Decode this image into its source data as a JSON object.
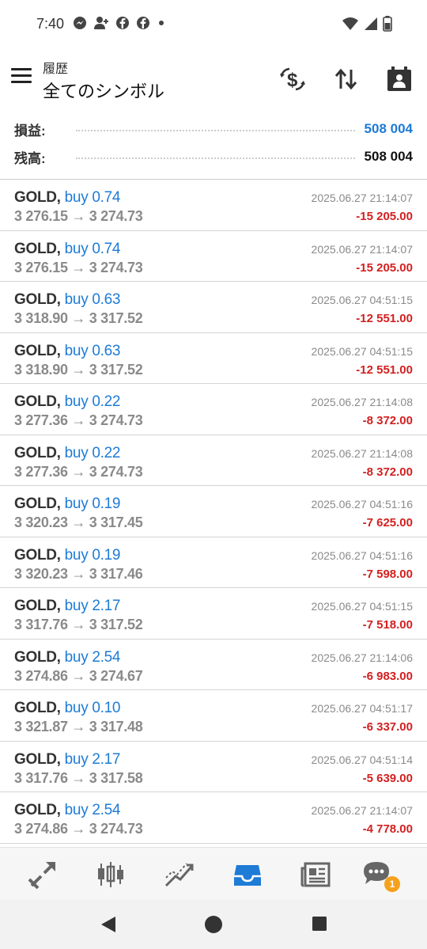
{
  "status": {
    "time": "7:40",
    "left_icons": [
      "messenger-icon",
      "add-person-icon",
      "facebook-icon",
      "facebook-icon",
      "dot-icon"
    ],
    "right_icons": [
      "wifi-icon",
      "signal-icon",
      "battery-icon"
    ]
  },
  "header": {
    "subtitle": "履歴",
    "title": "全てのシンボル"
  },
  "summary": {
    "profit_label": "損益:",
    "profit_value": "508 004",
    "profit_color": "#1e7bd6",
    "balance_label": "残高:",
    "balance_value": "508 004"
  },
  "trades": [
    {
      "symbol": "GOLD,",
      "side": "buy 0.74",
      "prices": "3 276.15 → 3 274.73",
      "time": "2025.06.27 21:14:07",
      "profit": "-15 205.00"
    },
    {
      "symbol": "GOLD,",
      "side": "buy 0.74",
      "prices": "3 276.15 → 3 274.73",
      "time": "2025.06.27 21:14:07",
      "profit": "-15 205.00"
    },
    {
      "symbol": "GOLD,",
      "side": "buy 0.63",
      "prices": "3 318.90 → 3 317.52",
      "time": "2025.06.27 04:51:15",
      "profit": "-12 551.00"
    },
    {
      "symbol": "GOLD,",
      "side": "buy 0.63",
      "prices": "3 318.90 → 3 317.52",
      "time": "2025.06.27 04:51:15",
      "profit": "-12 551.00"
    },
    {
      "symbol": "GOLD,",
      "side": "buy 0.22",
      "prices": "3 277.36 → 3 274.73",
      "time": "2025.06.27 21:14:08",
      "profit": "-8 372.00"
    },
    {
      "symbol": "GOLD,",
      "side": "buy 0.22",
      "prices": "3 277.36 → 3 274.73",
      "time": "2025.06.27 21:14:08",
      "profit": "-8 372.00"
    },
    {
      "symbol": "GOLD,",
      "side": "buy 0.19",
      "prices": "3 320.23 → 3 317.45",
      "time": "2025.06.27 04:51:16",
      "profit": "-7 625.00"
    },
    {
      "symbol": "GOLD,",
      "side": "buy 0.19",
      "prices": "3 320.23 → 3 317.46",
      "time": "2025.06.27 04:51:16",
      "profit": "-7 598.00"
    },
    {
      "symbol": "GOLD,",
      "side": "buy 2.17",
      "prices": "3 317.76 → 3 317.52",
      "time": "2025.06.27 04:51:15",
      "profit": "-7 518.00"
    },
    {
      "symbol": "GOLD,",
      "side": "buy 2.54",
      "prices": "3 274.86 → 3 274.67",
      "time": "2025.06.27 21:14:06",
      "profit": "-6 983.00"
    },
    {
      "symbol": "GOLD,",
      "side": "buy 0.10",
      "prices": "3 321.87 → 3 317.48",
      "time": "2025.06.27 04:51:17",
      "profit": "-6 337.00"
    },
    {
      "symbol": "GOLD,",
      "side": "buy 2.17",
      "prices": "3 317.76 → 3 317.58",
      "time": "2025.06.27 04:51:14",
      "profit": "-5 639.00"
    },
    {
      "symbol": "GOLD,",
      "side": "buy 2.54",
      "prices": "3 274.86 → 3 274.73",
      "time": "2025.06.27 21:14:07",
      "profit": "-4 778.00"
    }
  ],
  "colors": {
    "accent": "#1e7bd6",
    "loss": "#d32020",
    "badge": "#f5a11b"
  },
  "bottom_nav": {
    "items": [
      "quotes-icon",
      "chart-icon",
      "trade-icon",
      "history-icon",
      "news-icon",
      "chat-icon"
    ],
    "active": "history-icon",
    "chat_badge": "1"
  }
}
